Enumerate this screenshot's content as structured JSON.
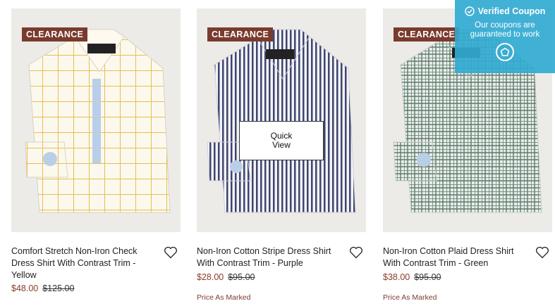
{
  "products": [
    {
      "badge": "CLEARANCE",
      "title": "Comfort Stretch Non-Iron Check Dress Shirt With Contrast Trim - Yellow",
      "price": "$48.00",
      "old_price": "$125.00",
      "note": "",
      "icon": "heart-outline-icon"
    },
    {
      "badge": "CLEARANCE",
      "title": "Non-Iron Cotton Stripe Dress Shirt With Contrast Trim - Purple",
      "price": "$28.00",
      "old_price": "$95.00",
      "note": "Price As Marked",
      "icon": "heart-outline-icon",
      "quick_view": "Quick View"
    },
    {
      "badge": "CLEARANCE",
      "title": "Non-Iron Cotton Plaid Dress Shirt With Contrast Trim - Green",
      "price": "$38.00",
      "old_price": "$95.00",
      "note": "Price As Marked",
      "icon": "heart-outline-icon"
    }
  ],
  "coupon": {
    "title": "Verified Coupon",
    "text": "Our coupons are guaranteed to work",
    "icon": "home-pentagon-icon",
    "check_icon": "check-circle-icon"
  },
  "colors": {
    "badge_bg": "#7a3b2e",
    "sale_price": "#8b3a2b",
    "coupon_bg": "#32aad2",
    "image_bg": "#ecebe8"
  }
}
